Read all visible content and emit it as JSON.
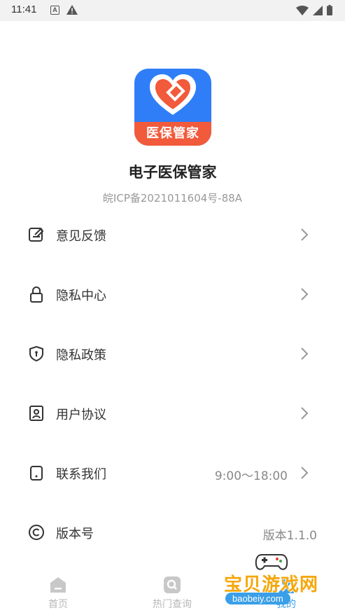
{
  "status_bar": {
    "time": "11:41",
    "notification_icons": [
      "a-icon",
      "warning-icon"
    ],
    "system_icons": [
      "wifi-icon",
      "signal-icon",
      "battery-icon"
    ]
  },
  "app": {
    "name": "电子医保管家",
    "icon_text": "医保管家",
    "icp": "皖ICP备2021011604号-88A"
  },
  "menu": [
    {
      "label": "意见反馈",
      "icon": "feedback-icon",
      "value": "",
      "arrow": true
    },
    {
      "label": "隐私中心",
      "icon": "lock-icon",
      "value": "",
      "arrow": true
    },
    {
      "label": "隐私政策",
      "icon": "shield-icon",
      "value": "",
      "arrow": true
    },
    {
      "label": "用户协议",
      "icon": "user-agreement-icon",
      "value": "",
      "arrow": true
    },
    {
      "label": "联系我们",
      "icon": "phone-icon",
      "value": "9:00～18:00",
      "arrow": true
    },
    {
      "label": "版本号",
      "icon": "copyright-icon",
      "value": "版本1.1.0",
      "arrow": false
    }
  ],
  "tabs": [
    {
      "label": "首页",
      "icon": "home-icon"
    },
    {
      "label": "热门查询",
      "icon": "search-icon"
    },
    {
      "label": "我的",
      "icon": "profile-icon"
    }
  ],
  "watermark": {
    "text": "宝贝游戏网",
    "url": "baobeiy.com"
  },
  "colors": {
    "icon_blue": "#2f7ef7",
    "icon_red": "#f15a3b",
    "tab_inactive": "#b8b8b8",
    "watermark_orange": "#f5a70c"
  }
}
